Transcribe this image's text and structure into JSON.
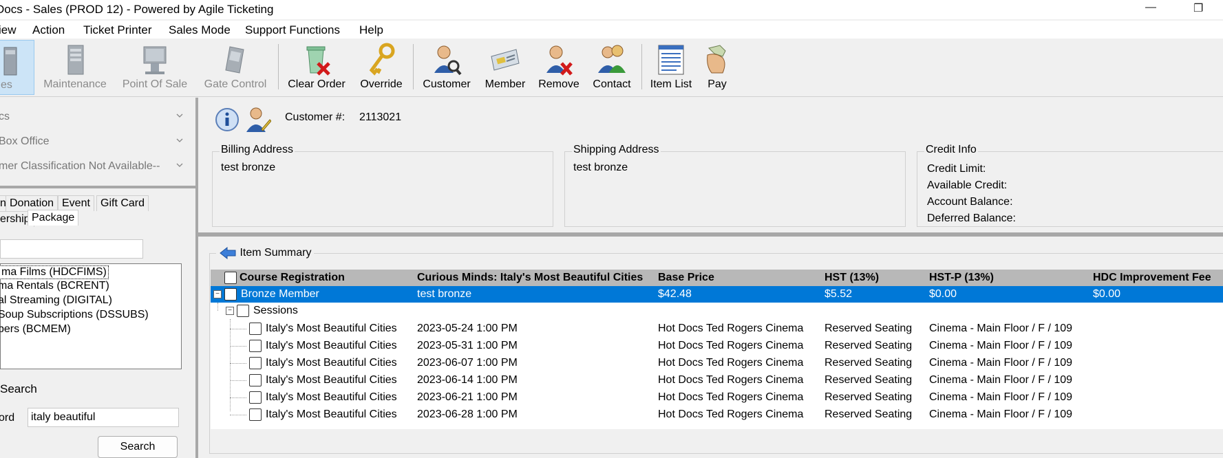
{
  "window": {
    "title": "Docs - Sales (PROD 12) - Powered by Agile Ticketing"
  },
  "menu": [
    "iew",
    "Action",
    "Ticket Printer",
    "Sales Mode",
    "Support Functions",
    "Help"
  ],
  "toolbar": {
    "sales": "es",
    "maintenance": "Maintenance",
    "point_of_sale": "Point Of Sale",
    "gate_control": "Gate Control",
    "clear_order": "Clear Order",
    "override": "Override",
    "customer": "Customer",
    "member": "Member",
    "remove": "Remove",
    "contact": "Contact",
    "item_list": "Item List",
    "pay": "Pay"
  },
  "left": {
    "combo1": "cs",
    "combo2": "Box Office",
    "combo3": "mer Classification Not Available--",
    "tabs_row1": [
      "n",
      "Donation",
      "Event",
      "Gift Card"
    ],
    "tabs_row2": [
      "ership",
      "Package"
    ],
    "filter_value": "",
    "list_items": [
      "ma Films  (HDCFIMS)",
      "ma Rentals  (BCRENT)",
      "al Streaming  (DIGITAL)",
      "Soup Subscriptions  (DSSUBS)",
      "bers  (BCMEM)"
    ],
    "search_label": "Search",
    "keyword_label": "ord",
    "keyword_value": "italy beautiful",
    "search_button": "Search"
  },
  "customer": {
    "number_label": "Customer #:",
    "number_value": "2113021",
    "billing_title": "Billing Address",
    "billing_value": "test bronze",
    "shipping_title": "Shipping Address",
    "shipping_value": "test bronze",
    "credit_title": "Credit Info",
    "credit_limit": "Credit Limit:",
    "available_credit": "Available Credit:",
    "account_balance": "Account Balance:",
    "deferred_balance": "Deferred Balance:"
  },
  "items": {
    "title": "Item Summary",
    "columns": [
      "Course Registration",
      "Curious Minds: Italy's Most Beautiful Cities",
      "Base Price",
      "HST (13%)",
      "HST-P (13%)",
      "HDC Improvement Fee"
    ],
    "member_row": [
      "Bronze Member",
      "test bronze",
      "$42.48",
      "$5.52",
      "$0.00",
      "$0.00"
    ],
    "sessions_label": "Sessions",
    "sessions": [
      [
        "Italy's Most Beautiful Cities",
        "2023-05-24 1:00 PM",
        "Hot Docs Ted Rogers Cinema",
        "Reserved Seating",
        "Cinema - Main Floor / F / 109"
      ],
      [
        "Italy's Most Beautiful Cities",
        "2023-05-31 1:00 PM",
        "Hot Docs Ted Rogers Cinema",
        "Reserved Seating",
        "Cinema - Main Floor / F / 109"
      ],
      [
        "Italy's Most Beautiful Cities",
        "2023-06-07 1:00 PM",
        "Hot Docs Ted Rogers Cinema",
        "Reserved Seating",
        "Cinema - Main Floor / F / 109"
      ],
      [
        "Italy's Most Beautiful Cities",
        "2023-06-14 1:00 PM",
        "Hot Docs Ted Rogers Cinema",
        "Reserved Seating",
        "Cinema - Main Floor / F / 109"
      ],
      [
        "Italy's Most Beautiful Cities",
        "2023-06-21 1:00 PM",
        "Hot Docs Ted Rogers Cinema",
        "Reserved Seating",
        "Cinema - Main Floor / F / 109"
      ],
      [
        "Italy's Most Beautiful Cities",
        "2023-06-28 1:00 PM",
        "Hot Docs Ted Rogers Cinema",
        "Reserved Seating",
        "Cinema - Main Floor / F / 109"
      ]
    ]
  },
  "colors": {
    "selection": "#0078d7",
    "header": "#b8b8b8",
    "splitter": "#a8a8a8"
  }
}
